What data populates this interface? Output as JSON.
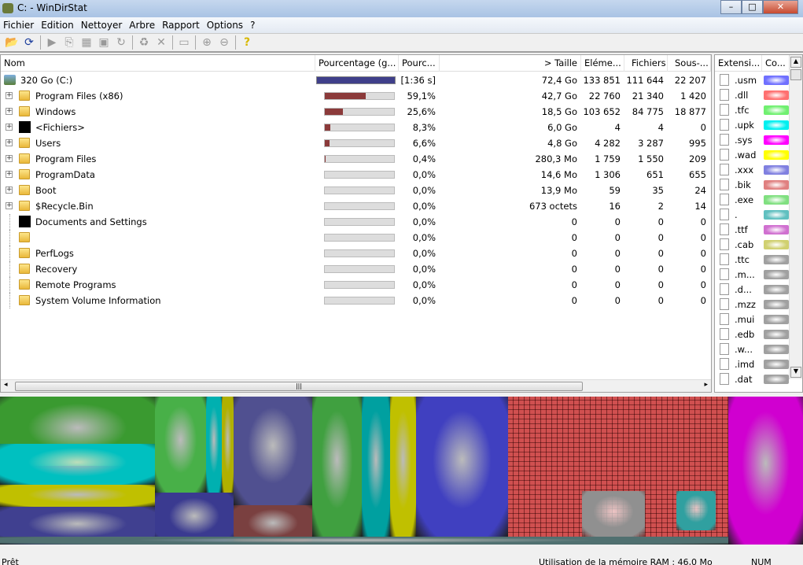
{
  "window": {
    "title": "C: - WinDirStat",
    "minimize": "–",
    "maximize": "□",
    "close": "✕"
  },
  "menu": [
    "Fichier",
    "Edition",
    "Nettoyer",
    "Arbre",
    "Rapport",
    "Options",
    "?"
  ],
  "columns": {
    "name": "Nom",
    "pct_graph": "Pourcentage (g...",
    "pct": "Pourc...",
    "size": "> Taille",
    "items": "Eléme...",
    "files": "Fichiers",
    "subdirs": "Sous-..."
  },
  "rows": [
    {
      "name": "320 Go (C:)",
      "pct": "[1:36 s]",
      "fill": 100,
      "size": "72,4 Go",
      "items": "133 851",
      "files": "111 644",
      "subdirs": "22 207",
      "icon": "drive",
      "exp": false
    },
    {
      "name": "Program Files (x86)",
      "pct": "59,1%",
      "fill": 59.1,
      "size": "42,7 Go",
      "items": "22 760",
      "files": "21 340",
      "subdirs": "1 420",
      "icon": "folder",
      "exp": true
    },
    {
      "name": "Windows",
      "pct": "25,6%",
      "fill": 25.6,
      "size": "18,5 Go",
      "items": "103 652",
      "files": "84 775",
      "subdirs": "18 877",
      "icon": "folder",
      "exp": true
    },
    {
      "name": "<Fichiers>",
      "pct": "8,3%",
      "fill": 8.3,
      "size": "6,0 Go",
      "items": "4",
      "files": "4",
      "subdirs": "0",
      "icon": "black",
      "exp": true
    },
    {
      "name": "Users",
      "pct": "6,6%",
      "fill": 6.6,
      "size": "4,8 Go",
      "items": "4 282",
      "files": "3 287",
      "subdirs": "995",
      "icon": "folder",
      "exp": true
    },
    {
      "name": "Program Files",
      "pct": "0,4%",
      "fill": 0.4,
      "size": "280,3 Mo",
      "items": "1 759",
      "files": "1 550",
      "subdirs": "209",
      "icon": "folder",
      "exp": true
    },
    {
      "name": "ProgramData",
      "pct": "0,0%",
      "fill": 0,
      "size": "14,6 Mo",
      "items": "1 306",
      "files": "651",
      "subdirs": "655",
      "icon": "folder",
      "exp": true
    },
    {
      "name": "Boot",
      "pct": "0,0%",
      "fill": 0,
      "size": "13,9 Mo",
      "items": "59",
      "files": "35",
      "subdirs": "24",
      "icon": "folder",
      "exp": true
    },
    {
      "name": "$Recycle.Bin",
      "pct": "0,0%",
      "fill": 0,
      "size": "673 octets",
      "items": "16",
      "files": "2",
      "subdirs": "14",
      "icon": "folder",
      "exp": true
    },
    {
      "name": "Documents and Settings",
      "pct": "0,0%",
      "fill": 0,
      "size": "0",
      "items": "0",
      "files": "0",
      "subdirs": "0",
      "icon": "black",
      "exp": false
    },
    {
      "name": "",
      "pct": "0,0%",
      "fill": 0,
      "size": "0",
      "items": "0",
      "files": "0",
      "subdirs": "0",
      "icon": "folder",
      "exp": false
    },
    {
      "name": "PerfLogs",
      "pct": "0,0%",
      "fill": 0,
      "size": "0",
      "items": "0",
      "files": "0",
      "subdirs": "0",
      "icon": "folder",
      "exp": false
    },
    {
      "name": "Recovery",
      "pct": "0,0%",
      "fill": 0,
      "size": "0",
      "items": "0",
      "files": "0",
      "subdirs": "0",
      "icon": "folder",
      "exp": false
    },
    {
      "name": "Remote Programs",
      "pct": "0,0%",
      "fill": 0,
      "size": "0",
      "items": "0",
      "files": "0",
      "subdirs": "0",
      "icon": "folder",
      "exp": false
    },
    {
      "name": "System Volume Information",
      "pct": "0,0%",
      "fill": 0,
      "size": "0",
      "items": "0",
      "files": "0",
      "subdirs": "0",
      "icon": "folder",
      "exp": false
    }
  ],
  "ext_columns": {
    "ext": "Extensi...",
    "color": "Co..."
  },
  "extensions": [
    {
      "ext": ".usm",
      "color": "#7070ff"
    },
    {
      "ext": ".dll",
      "color": "#ff7070"
    },
    {
      "ext": ".tfc",
      "color": "#70f070"
    },
    {
      "ext": ".upk",
      "color": "#00f0f0"
    },
    {
      "ext": ".sys",
      "color": "#ff00ff"
    },
    {
      "ext": ".wad",
      "color": "#ffff00"
    },
    {
      "ext": ".xxx",
      "color": "#8080e0"
    },
    {
      "ext": ".bik",
      "color": "#e08080"
    },
    {
      "ext": ".exe",
      "color": "#80e080"
    },
    {
      "ext": ".",
      "color": "#60c0c0"
    },
    {
      "ext": ".ttf",
      "color": "#d070d0"
    },
    {
      "ext": ".cab",
      "color": "#d0d070"
    },
    {
      "ext": ".ttc",
      "color": "#a0a0a0"
    },
    {
      "ext": ".m...",
      "color": "#a0a0a0"
    },
    {
      "ext": ".d...",
      "color": "#a0a0a0"
    },
    {
      "ext": ".mzz",
      "color": "#a0a0a0"
    },
    {
      "ext": ".mui",
      "color": "#a0a0a0"
    },
    {
      "ext": ".edb",
      "color": "#a0a0a0"
    },
    {
      "ext": ".w...",
      "color": "#a0a0a0"
    },
    {
      "ext": ".imd",
      "color": "#a0a0a0"
    },
    {
      "ext": ".dat",
      "color": "#a0a0a0"
    }
  ],
  "status": {
    "ready": "Prêt",
    "memory": "Utilisation de la mémoire RAM :   46,0 Mo",
    "num": "NUM"
  },
  "colors": {
    "root_bar": "#3f3f8a",
    "bar": "#8b3a3a"
  }
}
